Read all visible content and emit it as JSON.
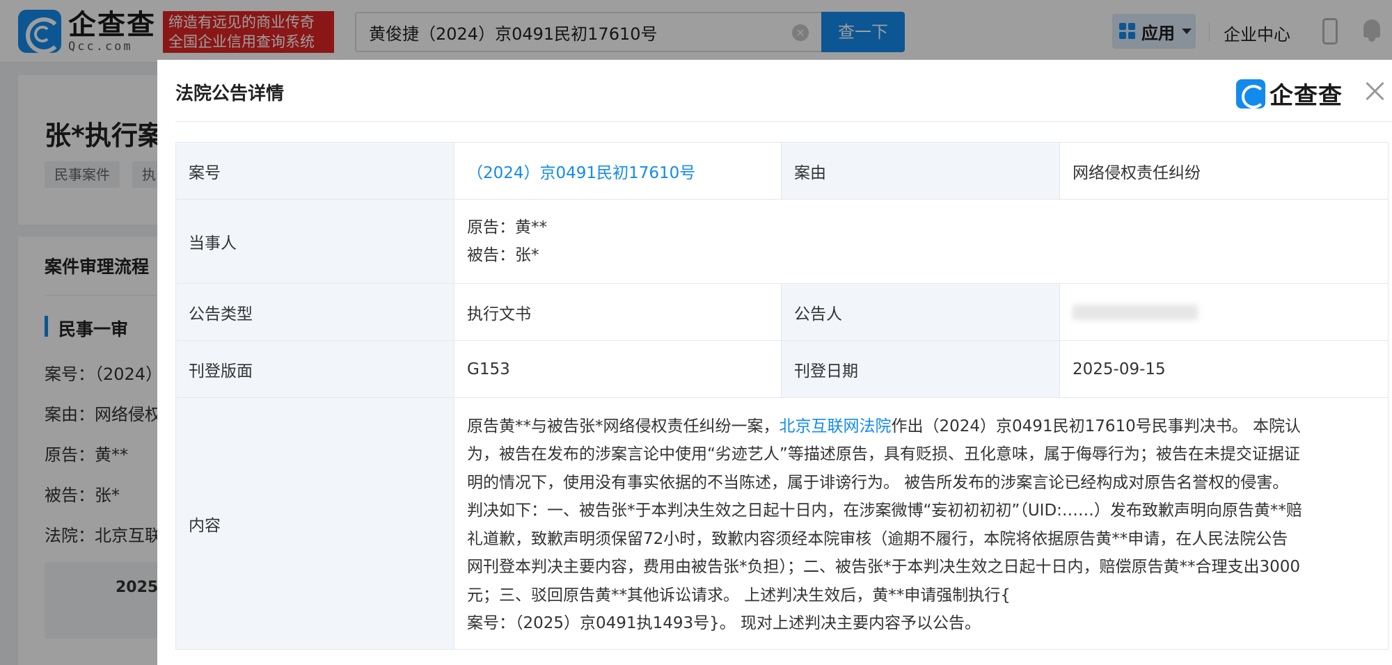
{
  "header": {
    "logo_cn": "企查查",
    "logo_en": "Qcc.com",
    "slogan_line1": "缔造有远见的商业传奇",
    "slogan_line2": "全国企业信用查询系统",
    "search_value": "黄俊捷（2024）京0491民初17610号",
    "search_button": "查一下",
    "apps_label": "应用",
    "enterprise_center": "企业中心"
  },
  "background_page": {
    "title": "张*执行案",
    "tags": [
      "民事案件",
      "执"
    ],
    "section_title": "案件审理流程",
    "stage": "民事一审",
    "rows": [
      {
        "label": "案号：",
        "value": "（2024）"
      },
      {
        "label": "案由：",
        "value": "网络侵权"
      },
      {
        "label": "原告：",
        "value": "黄**"
      },
      {
        "label": "被告：",
        "value": "张*"
      },
      {
        "label": "法院：",
        "value": "北京互联"
      }
    ],
    "box_text": "2025"
  },
  "modal": {
    "title": "法院公告详情",
    "brand": "企查查",
    "rows": {
      "case_no_label": "案号",
      "case_no_value": "（2024）京0491民初17610号",
      "cause_label": "案由",
      "cause_value": "网络侵权责任纠纷",
      "parties_label": "当事人",
      "plaintiff": "原告：黄**",
      "defendant": "被告：张*",
      "type_label": "公告类型",
      "type_value": "执行文书",
      "announcer_label": "公告人",
      "page_label": "刊登版面",
      "page_value": "G153",
      "date_label": "刊登日期",
      "date_value": "2025-09-15",
      "content_label": "内容",
      "content": {
        "l1_pre": "原告黄**与被告张*网络侵权责任纠纷一案，",
        "l1_court": "北京互联网法院",
        "l1_post": "作出（2024）京0491民初17610号民事判决书。 本院认",
        "l2": "为，被告在发布的涉案言论中使用“劣迹艺人”等描述原告，具有贬损、丑化意味，属于侮辱行为；被告在未提交证据证",
        "l3": "明的情况下，使用没有事实依据的不当陈述，属于诽谤行为。 被告所发布的涉案言论已经构成对原告名誉权的侵害。",
        "l4": "判决如下：一、被告张*于本判决生效之日起十日内，在涉案微博“妄初初初初”（UID:……）发布致歉声明向原告黄**赔",
        "l5": "礼道歉，致歉声明须保留72小时，致歉内容须经本院审核（逾期不履行，本院将依据原告黄**申请，在人民法院公告",
        "l6": "网刊登本判决主要内容，费用由被告张*负担）；二、被告张*于本判决生效之日起十日内，赔偿原告黄**合理支出3000",
        "l7": "元；三、驳回原告黄**其他诉讼请求。 上述判决生效后，黄**申请强制执行{",
        "l8": "案号：（2025）京0491执1493号}。 现对上述判决主要内容予以公告。"
      }
    }
  }
}
